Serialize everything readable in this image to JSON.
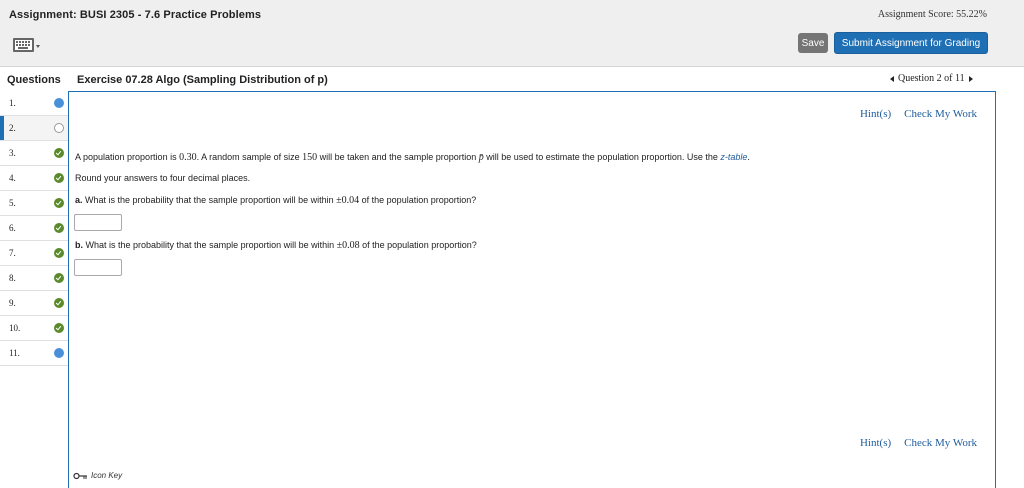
{
  "header": {
    "assignment_title": "Assignment: BUSI 2305 - 7.6 Practice Problems",
    "score": "Assignment Score: 55.22%",
    "save_label": "Save",
    "submit_label": "Submit Assignment for Grading",
    "keyboard_icon": "keyboard-icon"
  },
  "question_header": {
    "questions_label": "Questions",
    "exercise_title": "Exercise 07.28 Algo (Sampling Distribution of p)",
    "nav_label": "Question 2 of 11"
  },
  "questions": [
    {
      "num": "1.",
      "status": "partial"
    },
    {
      "num": "2.",
      "status": "empty"
    },
    {
      "num": "3.",
      "status": "done"
    },
    {
      "num": "4.",
      "status": "done"
    },
    {
      "num": "5.",
      "status": "done"
    },
    {
      "num": "6.",
      "status": "done"
    },
    {
      "num": "7.",
      "status": "done"
    },
    {
      "num": "8.",
      "status": "done"
    },
    {
      "num": "9.",
      "status": "done"
    },
    {
      "num": "10.",
      "status": "done"
    },
    {
      "num": "11.",
      "status": "partial"
    }
  ],
  "links": {
    "hint": "Hint(s)",
    "check": "Check My Work"
  },
  "problem": {
    "p1_a": "A population proportion is ",
    "p1_val1": "0.30",
    "p1_b": ". A random sample of size ",
    "p1_val2": "150",
    "p1_c": " will be taken and the sample proportion ",
    "p1_pbar": "p̄",
    "p1_d": " will be used to estimate the population proportion. Use the ",
    "p1_link": "z-table",
    "p1_e": ".",
    "round": "Round your answers to four decimal places.",
    "a_label": "a.",
    "a_text": " What is the probability that the sample proportion will be within ",
    "a_val": "±0.04",
    "a_end": " of the population proportion?",
    "b_label": "b.",
    "b_text": " What is the probability that the sample proportion will be within ",
    "b_val": "±0.08",
    "b_end": " of the population proportion?",
    "a_answer": "",
    "b_answer": ""
  },
  "icon_key": "Icon Key",
  "colors": {
    "accent": "#1e6fb4",
    "done": "#5a8a2a",
    "partial": "#4a90d9"
  }
}
